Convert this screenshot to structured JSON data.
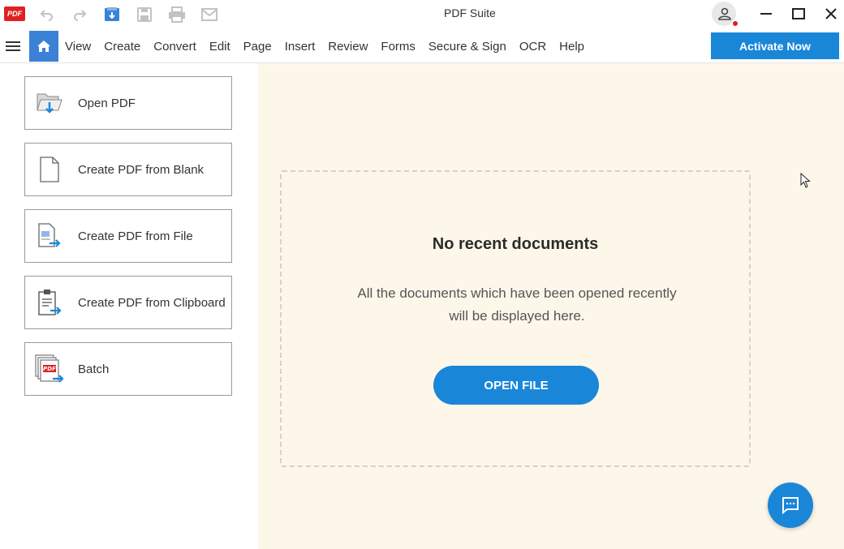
{
  "app": {
    "title": "PDF Suite",
    "logo_text": "PDF"
  },
  "quick_access": [
    {
      "name": "undo-icon"
    },
    {
      "name": "redo-icon"
    },
    {
      "name": "import-icon"
    },
    {
      "name": "save-icon"
    },
    {
      "name": "print-icon"
    },
    {
      "name": "email-icon"
    }
  ],
  "menu": {
    "items": [
      "View",
      "Create",
      "Convert",
      "Edit",
      "Page",
      "Insert",
      "Review",
      "Forms",
      "Secure & Sign",
      "OCR",
      "Help"
    ],
    "activate_label": "Activate Now"
  },
  "actions": [
    {
      "label": "Open PDF",
      "icon": "open-folder-icon"
    },
    {
      "label": "Create PDF from Blank",
      "icon": "blank-page-icon"
    },
    {
      "label": "Create PDF from File",
      "icon": "file-convert-icon"
    },
    {
      "label": "Create PDF from Clipboard",
      "icon": "clipboard-icon"
    },
    {
      "label": "Batch",
      "icon": "batch-icon"
    }
  ],
  "recent": {
    "title": "No recent documents",
    "description": "All the documents which have been opened recently will be displayed here.",
    "open_file_label": "OPEN FILE"
  },
  "colors": {
    "accent": "#1a86d8",
    "home": "#3b82d6",
    "logo": "#e02020",
    "main_bg": "#fdf7ea"
  }
}
